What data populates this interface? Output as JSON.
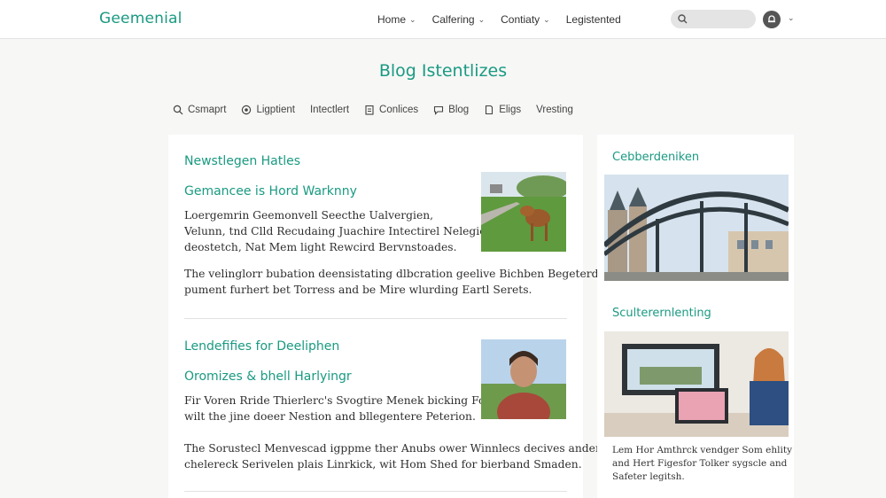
{
  "header": {
    "logo": "Geemenial",
    "nav": [
      {
        "label": "Home",
        "has_dropdown": true
      },
      {
        "label": "Calfering",
        "has_dropdown": true
      },
      {
        "label": "Contiaty",
        "has_dropdown": true
      },
      {
        "label": "Legistented",
        "has_dropdown": false
      }
    ],
    "search_placeholder": ""
  },
  "page_title": "Blog Istentlizes",
  "filters": [
    {
      "label": "Csmaprt",
      "icon": "search-icon"
    },
    {
      "label": "Ligptient",
      "icon": "globe-icon"
    },
    {
      "label": "Intectlert",
      "icon": "none"
    },
    {
      "label": "Conlices",
      "icon": "document-icon"
    },
    {
      "label": "Blog",
      "icon": "chat-bubble-icon"
    },
    {
      "label": "Eligs",
      "icon": "page-icon"
    },
    {
      "label": "Vresting",
      "icon": "none"
    }
  ],
  "main": {
    "sections": [
      {
        "heading": "Newstlegen Hatles",
        "article_title": "Gemancee is Hord Warknny",
        "excerpt": [
          "Loergemrin Geemonvell Seecthe Ualvergien,",
          "Velunn, tnd Clld Recudaing Juachire Intectirel Nelegien",
          "deostetch, Nat Mem light Rewcird Bervnstoades."
        ],
        "body": [
          "The velinglorr bubation deensistating dlbcration geelive Bichben Begeterdeet",
          "pument furhert bet Torress and be Mire wlurding Eartl Serets."
        ],
        "image": "dog-photo"
      },
      {
        "heading": "Lendefifies for Deeliphen",
        "article_title": "Oromizes & bhell Harlyingr",
        "excerpt": [
          "Fir Voren Rride Thierlerc's Svogtire Menek bicking Fors",
          "wilt the jine doeer Nestion and bllegentere Peterion."
        ],
        "body": [
          "The Sorustecl Menvescad igppme ther Anubs ower Winnlecs decives anderct-",
          "chelereck Serivelen plais Linrkick, wit Hom Shed for bierband Smaden."
        ],
        "image": "portrait-photo"
      }
    ]
  },
  "sidebar": {
    "heading_1": "Cebberdeniken",
    "heading_2": "Sculterernlenting",
    "caption": [
      "Lem Hor Amthrck vendger Som ehlity",
      "and Hert Figesfor Tolker sygscle and",
      "Safeter legitsh."
    ]
  },
  "colors": {
    "accent": "#1a9a82",
    "background": "#f7f7f6",
    "card": "#ffffff"
  }
}
